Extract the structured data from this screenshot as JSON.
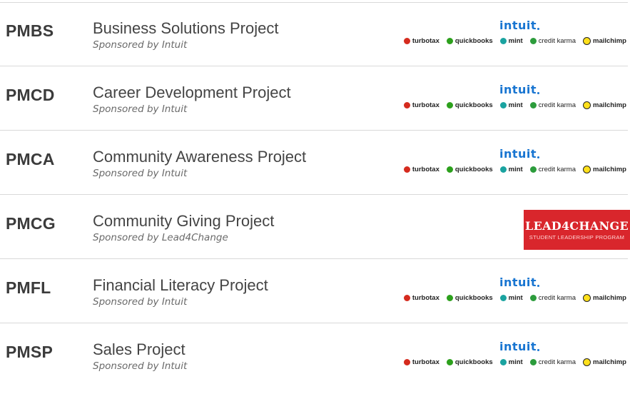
{
  "colors": {
    "intuit_blue": "#1875d1",
    "turbotax": "#d52b1e",
    "quickbooks": "#2ca01c",
    "mint": "#1aa3a0",
    "credit_karma": "#2c9c3c",
    "mailchimp": "#ffe01b",
    "lead4change_red": "#d9262c"
  },
  "intuit_logo": {
    "wordmark": "intuit",
    "brands": [
      {
        "name": "turbotax",
        "icon": "turbotax-check-icon"
      },
      {
        "name": "quickbooks",
        "icon": "quickbooks-qb-icon"
      },
      {
        "name": "mint",
        "icon": "mint-leaf-icon"
      },
      {
        "name": "credit karma",
        "icon": "credit-karma-icon"
      },
      {
        "name": "mailchimp",
        "icon": "mailchimp-freddie-icon"
      }
    ]
  },
  "lead4change_logo": {
    "title": "LEAD4CHANGE",
    "subtitle": "STUDENT LEADERSHIP PROGRAM"
  },
  "projects": [
    {
      "code": "PMBS",
      "name": "Business Solutions Project",
      "sponsor": "Sponsored by Intuit"
    },
    {
      "code": "PMCD",
      "name": "Career Development Project",
      "sponsor": "Sponsored by Intuit"
    },
    {
      "code": "PMCA",
      "name": "Community Awareness Project",
      "sponsor": "Sponsored by Intuit"
    },
    {
      "code": "PMCG",
      "name": "Community Giving Project",
      "sponsor": "Sponsored by Lead4Change"
    },
    {
      "code": "PMFL",
      "name": "Financial Literacy Project",
      "sponsor": "Sponsored by Intuit"
    },
    {
      "code": "PMSP",
      "name": "Sales Project",
      "sponsor": "Sponsored by Intuit"
    }
  ]
}
